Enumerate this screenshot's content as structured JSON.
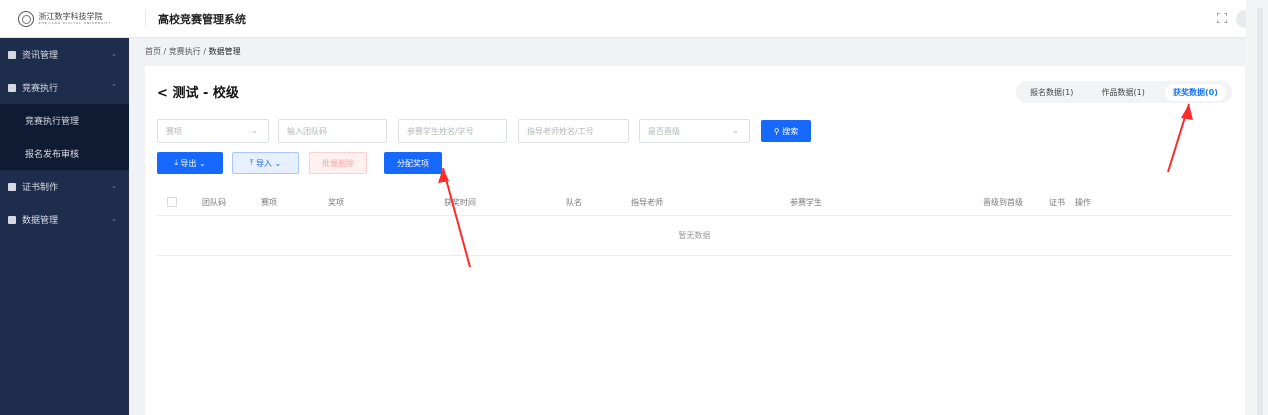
{
  "header": {
    "logo_text": "浙江数字科技学院",
    "logo_sub": "ZHEJIANG DIGITAL UNIVERSITY",
    "app_title": "高校竞赛管理系统"
  },
  "sidebar": {
    "items": [
      {
        "label": "资讯管理",
        "icon": "news-icon"
      },
      {
        "label": "竞赛执行",
        "icon": "competition-icon"
      },
      {
        "label": "竞赛执行管理"
      },
      {
        "label": "报名发布审核"
      },
      {
        "label": "证书制作",
        "icon": "certificate-icon"
      },
      {
        "label": "数据管理",
        "icon": "data-icon"
      }
    ]
  },
  "breadcrumb": {
    "home": "首页",
    "level1": "竞赛执行",
    "current": "数据管理",
    "sep": "/"
  },
  "page": {
    "title": "测试 - 校级",
    "back": "<"
  },
  "tabs": [
    {
      "label": "报名数据(1)"
    },
    {
      "label": "作品数据(1)"
    },
    {
      "label": "获奖数据(0)"
    }
  ],
  "filters": {
    "event": "赛项",
    "team_code": "输入团队码",
    "student": "参赛学生姓名/学号",
    "teacher": "指导老师姓名/工号",
    "promoted": "是否晋级",
    "search": "搜索"
  },
  "actions": {
    "export": "导出",
    "import": "导入",
    "batch_delete": "批量删除",
    "assign_award": "分配奖项"
  },
  "table": {
    "columns": [
      "团队码",
      "赛项",
      "奖项",
      "获奖时间",
      "队名",
      "指导老师",
      "参赛学生",
      "晋级到首级",
      "证书",
      "操作"
    ],
    "empty_text": "暂无数据"
  },
  "colors": {
    "primary": "#1668ff",
    "sidebar": "#1f2d4d",
    "annotation": "#ff2a2a"
  }
}
